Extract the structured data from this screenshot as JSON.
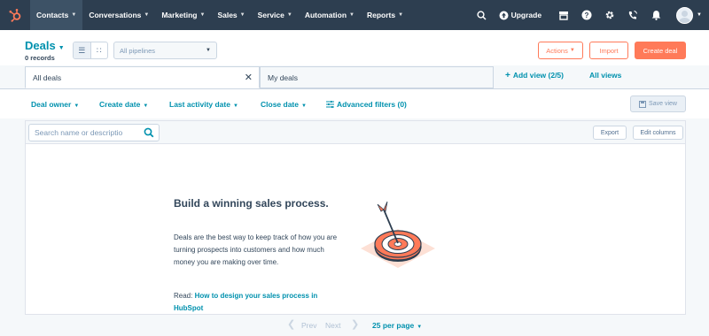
{
  "nav": {
    "items": [
      {
        "label": "Contacts"
      },
      {
        "label": "Conversations"
      },
      {
        "label": "Marketing"
      },
      {
        "label": "Sales"
      },
      {
        "label": "Service"
      },
      {
        "label": "Automation"
      },
      {
        "label": "Reports"
      }
    ],
    "upgrade_label": "Upgrade"
  },
  "header": {
    "title": "Deals",
    "records": "0 records",
    "pipeline_placeholder": "All pipelines",
    "actions_label": "Actions",
    "import_label": "Import",
    "create_label": "Create deal"
  },
  "tabs": {
    "all_deals": "All deals",
    "my_deals": "My deals",
    "add_view": "Add view (2/5)",
    "all_views": "All views"
  },
  "filters": {
    "deal_owner": "Deal owner",
    "create_date": "Create date",
    "last_activity": "Last activity date",
    "close_date": "Close date",
    "advanced": "Advanced filters (0)",
    "save_view": "Save view"
  },
  "table": {
    "search_placeholder": "Search name or descriptio",
    "export_label": "Export",
    "edit_columns_label": "Edit columns"
  },
  "empty": {
    "title": "Build a winning sales process.",
    "body": "Deals are the best way to keep track of how you are turning prospects into customers and how much money you are making over time.",
    "read_prefix": "Read:",
    "read_link": "How to design your sales process in HubSpot"
  },
  "pager": {
    "prev": "Prev",
    "next": "Next",
    "per_page": "25 per page"
  },
  "colors": {
    "nav_bg": "#2d3e50",
    "accent": "#ff7a59",
    "link": "#0091ae"
  }
}
